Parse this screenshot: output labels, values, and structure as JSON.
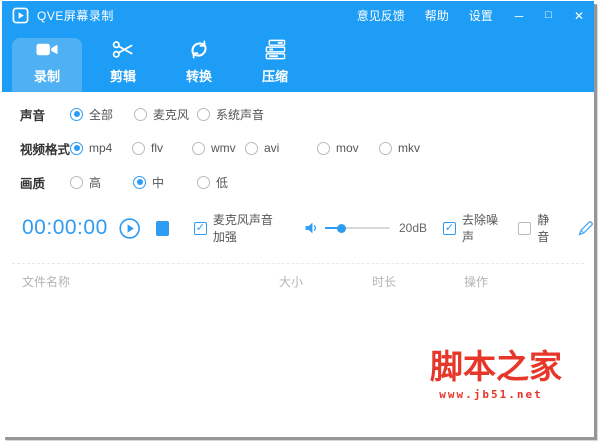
{
  "titlebar": {
    "app_title": "QVE屏幕录制",
    "menu": {
      "feedback": "意见反馈",
      "help": "帮助",
      "settings": "设置"
    },
    "window_controls": {
      "minimize": "─",
      "maximize": "□",
      "close": "✕"
    }
  },
  "tabs": {
    "record": {
      "label": "录制",
      "active": true,
      "icon": "video-camera-icon"
    },
    "edit": {
      "label": "剪辑",
      "active": false,
      "icon": "scissors-icon"
    },
    "convert": {
      "label": "转换",
      "active": false,
      "icon": "sync-arrows-icon"
    },
    "compress": {
      "label": "压缩",
      "active": false,
      "icon": "server-stack-icon"
    }
  },
  "settings": {
    "sound": {
      "label": "声音",
      "options": [
        {
          "label": "全部",
          "selected": true
        },
        {
          "label": "麦克风",
          "selected": false
        },
        {
          "label": "系统声音",
          "selected": false
        }
      ]
    },
    "video_format": {
      "label": "视频格式",
      "options": [
        {
          "label": "mp4",
          "selected": true
        },
        {
          "label": "flv",
          "selected": false
        },
        {
          "label": "wmv",
          "selected": false
        },
        {
          "label": "avi",
          "selected": false
        },
        {
          "label": "mov",
          "selected": false
        },
        {
          "label": "mkv",
          "selected": false
        }
      ]
    },
    "quality": {
      "label": "画质",
      "options": [
        {
          "label": "高",
          "selected": false
        },
        {
          "label": "中",
          "selected": true
        },
        {
          "label": "低",
          "selected": false
        }
      ]
    }
  },
  "recorder": {
    "timer": "00:00:00",
    "mic_boost_label": "麦克风声音加强",
    "mic_boost_checked": true,
    "gain_value": "20dB",
    "denoise_label": "去除噪声",
    "denoise_checked": true,
    "mute_label": "静音",
    "mute_checked": false
  },
  "file_list": {
    "columns": [
      "文件名称",
      "大小",
      "时长",
      "操作"
    ]
  },
  "watermark": {
    "site_name": "脚本之家",
    "site_url": "www.jb51.net"
  },
  "icons": {
    "check": "✓"
  },
  "colors": {
    "titlebar_blue": "#1d9df5",
    "active_tab_blue": "#4fb1f3",
    "accent_blue": "#2e9cf2",
    "watermark_red": "#e7372b"
  }
}
